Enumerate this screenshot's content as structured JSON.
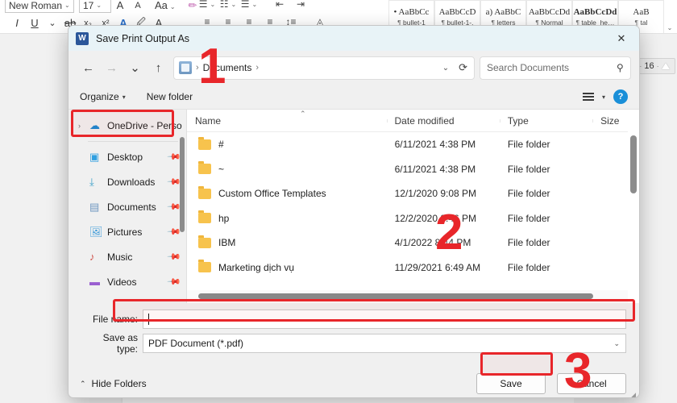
{
  "word": {
    "font_name": "New Roman",
    "font_size": "17",
    "zoom_spinner": "16",
    "ribbon_icons": [
      "font-grow-icon",
      "font-shrink-icon",
      "change-case-icon",
      "clear-formatting-icon",
      "italic-icon",
      "underline-icon",
      "strikethrough-icon",
      "subscript-icon",
      "superscript-icon",
      "text-effects-icon",
      "text-highlight-icon",
      "font-color-icon"
    ],
    "paragraph_icons": [
      "bullets-icon",
      "numbering-icon",
      "multilevel-list-icon",
      "decrease-indent-icon",
      "increase-indent-icon",
      "align-left-icon",
      "align-center-icon",
      "align-right-icon",
      "justify-icon",
      "line-spacing-icon",
      "shading-icon"
    ],
    "styles": [
      {
        "preview": "• AaBbCc",
        "name": "bullet-1",
        "bold": false
      },
      {
        "preview": "AaBbCcD",
        "name": "bullet-1-.",
        "bold": false
      },
      {
        "preview": "a) AaBbC",
        "name": "letters",
        "bold": false
      },
      {
        "preview": "AaBbCcDd",
        "name": "Normal",
        "bold": false
      },
      {
        "preview": "AaBbCcDd",
        "name": "table_he…",
        "bold": true
      },
      {
        "preview": "AaB",
        "name": "tal",
        "bold": false
      }
    ]
  },
  "dialog": {
    "title": "Save Print Output As",
    "app_icon": "W",
    "close_label": "✕",
    "nav": {
      "back": "←",
      "forward": "→",
      "recent": "⌄",
      "up": "↑",
      "breadcrumb": [
        "Documents"
      ],
      "breadcrumb_sep": "›",
      "dropdown": "⌄",
      "refresh": "⟳"
    },
    "search": {
      "placeholder": "Search Documents",
      "value": "",
      "icon": "search-icon"
    },
    "commands": {
      "organize": "Organize",
      "organize_caret": "▾",
      "new_folder": "New folder",
      "view_icon": "view-list-icon",
      "view_caret": "▾",
      "help": "?"
    },
    "sidebar": {
      "items": [
        {
          "label": "OneDrive - Perso",
          "icon": "onedrive-cloud-icon",
          "expander": "›",
          "pinned": false,
          "highlighted": true
        },
        {
          "label": "Desktop",
          "icon": "desktop-icon",
          "expander": "",
          "pinned": true,
          "highlighted": false
        },
        {
          "label": "Downloads",
          "icon": "downloads-icon",
          "expander": "",
          "pinned": true,
          "highlighted": false
        },
        {
          "label": "Documents",
          "icon": "documents-icon",
          "expander": "",
          "pinned": true,
          "highlighted": false
        },
        {
          "label": "Pictures",
          "icon": "pictures-icon",
          "expander": "",
          "pinned": true,
          "highlighted": false
        },
        {
          "label": "Music",
          "icon": "music-icon",
          "expander": "",
          "pinned": true,
          "highlighted": false
        },
        {
          "label": "Videos",
          "icon": "videos-icon",
          "expander": "",
          "pinned": true,
          "highlighted": false
        }
      ]
    },
    "filelist": {
      "columns": [
        "Name",
        "Date modified",
        "Type",
        "Size"
      ],
      "sort_indicator": "⌃",
      "rows": [
        {
          "name": "#",
          "date": "6/11/2021 4:38 PM",
          "type": "File folder",
          "size": ""
        },
        {
          "name": "~",
          "date": "6/11/2021 4:38 PM",
          "type": "File folder",
          "size": ""
        },
        {
          "name": "Custom Office Templates",
          "date": "12/1/2020 9:08 PM",
          "type": "File folder",
          "size": ""
        },
        {
          "name": "hp",
          "date": "12/2/2020 8:46 PM",
          "type": "File folder",
          "size": ""
        },
        {
          "name": "IBM",
          "date": "4/1/2022 8:44 PM",
          "type": "File folder",
          "size": ""
        },
        {
          "name": "Marketing dịch vụ",
          "date": "11/29/2021 6:49 AM",
          "type": "File folder",
          "size": ""
        }
      ]
    },
    "form": {
      "file_name_label": "File name:",
      "file_name_value": "",
      "save_as_type_label": "Save as type:",
      "save_as_type_value": "PDF Document (*.pdf)",
      "dropdown_caret": "⌄"
    },
    "footer": {
      "hide_folders": "Hide Folders",
      "hide_folders_chev": "⌃",
      "save": "Save",
      "cancel": "Cancel",
      "resize_grip": "◢"
    }
  },
  "annotations": {
    "highlight_color": "#e8262a",
    "steps": [
      {
        "number": "1"
      },
      {
        "number": "2"
      },
      {
        "number": "3"
      }
    ]
  }
}
